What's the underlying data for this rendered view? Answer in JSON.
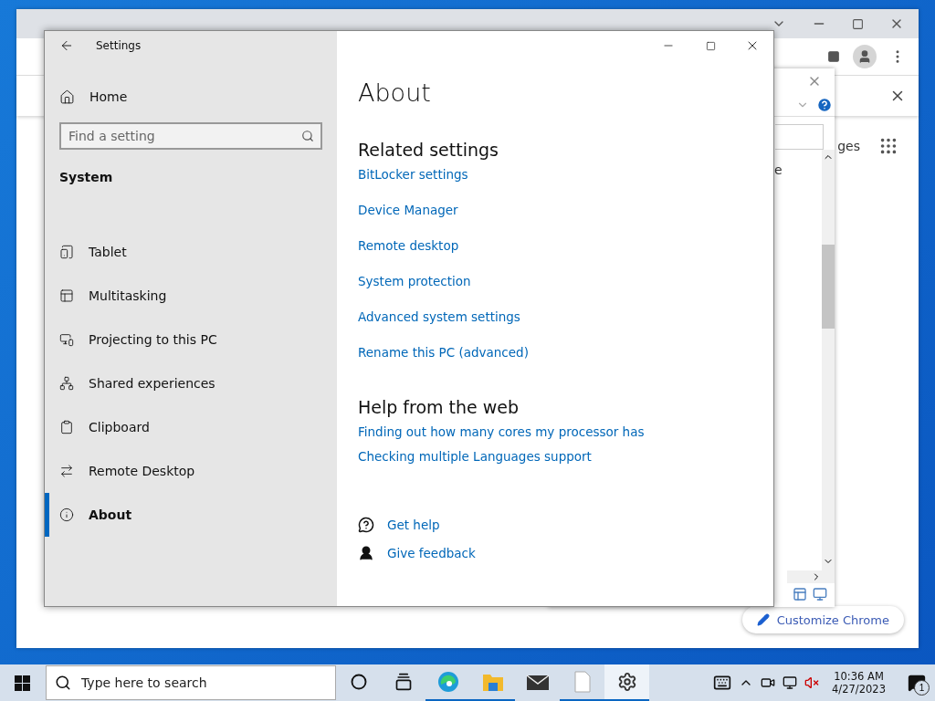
{
  "chrome_window": {
    "partial_text": "ges",
    "customize_button": "Customize Chrome"
  },
  "dialog": {
    "partial_text": "e"
  },
  "settings_window": {
    "title": "Settings",
    "home": "Home",
    "search": {
      "placeholder": "Find a setting"
    },
    "section": "System",
    "nav": [
      {
        "kind": "tablet",
        "label": "Tablet",
        "selected": false
      },
      {
        "kind": "multitasking",
        "label": "Multitasking",
        "selected": false
      },
      {
        "kind": "projecting",
        "label": "Projecting to this PC",
        "selected": false
      },
      {
        "kind": "shared",
        "label": "Shared experiences",
        "selected": false
      },
      {
        "kind": "clipboard",
        "label": "Clipboard",
        "selected": false
      },
      {
        "kind": "remote",
        "label": "Remote Desktop",
        "selected": false
      },
      {
        "kind": "about",
        "label": "About",
        "selected": true
      }
    ],
    "page_title": "About",
    "related": {
      "heading": "Related settings",
      "links": [
        "BitLocker settings",
        "Device Manager",
        "Remote desktop",
        "System protection",
        "Advanced system settings",
        "Rename this PC (advanced)"
      ]
    },
    "help": {
      "heading": "Help from the web",
      "links": [
        "Finding out how many cores my processor has",
        "Checking multiple Languages support"
      ]
    },
    "actions": [
      {
        "kind": "help",
        "label": "Get help"
      },
      {
        "kind": "feedback",
        "label": "Give feedback"
      }
    ]
  },
  "taskbar": {
    "search": {
      "placeholder": "Type here to search"
    },
    "apps": [
      {
        "kind": "cortana",
        "running": false,
        "selected": false
      },
      {
        "kind": "taskview",
        "running": false,
        "selected": false
      },
      {
        "kind": "edge",
        "running": true,
        "selected": false
      },
      {
        "kind": "explorer",
        "running": true,
        "selected": false
      },
      {
        "kind": "mail",
        "running": false,
        "selected": false
      },
      {
        "kind": "file",
        "running": true,
        "selected": false
      },
      {
        "kind": "settings",
        "running": true,
        "selected": true
      }
    ],
    "time": "10:36 AM",
    "date": "4/27/2023",
    "notifications": "1"
  }
}
